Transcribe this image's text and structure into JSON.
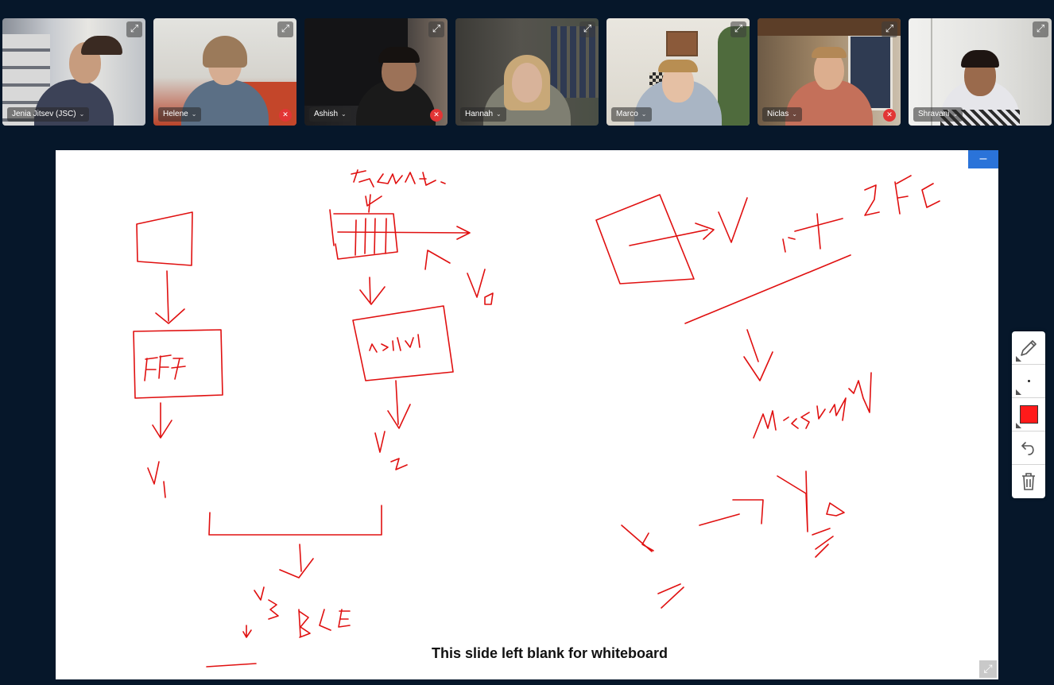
{
  "participants": [
    {
      "name": "Jenia Jitsev (JSC)",
      "muted": false
    },
    {
      "name": "Helene",
      "muted": true
    },
    {
      "name": "Ashish",
      "muted": true
    },
    {
      "name": "Hannah",
      "muted": false
    },
    {
      "name": "Marco",
      "muted": false
    },
    {
      "name": "Niclas",
      "muted": true
    },
    {
      "name": "Shravani",
      "muted": false
    }
  ],
  "whiteboard": {
    "caption": "This slide left blank for whiteboard",
    "minimize_label": "–",
    "ink_color": "#e01010"
  },
  "tools": {
    "pencil": "pencil-icon",
    "stroke_width": "dot-icon",
    "color": "#ff1a1a",
    "undo": "undo-icon",
    "clear": "trash-icon"
  }
}
